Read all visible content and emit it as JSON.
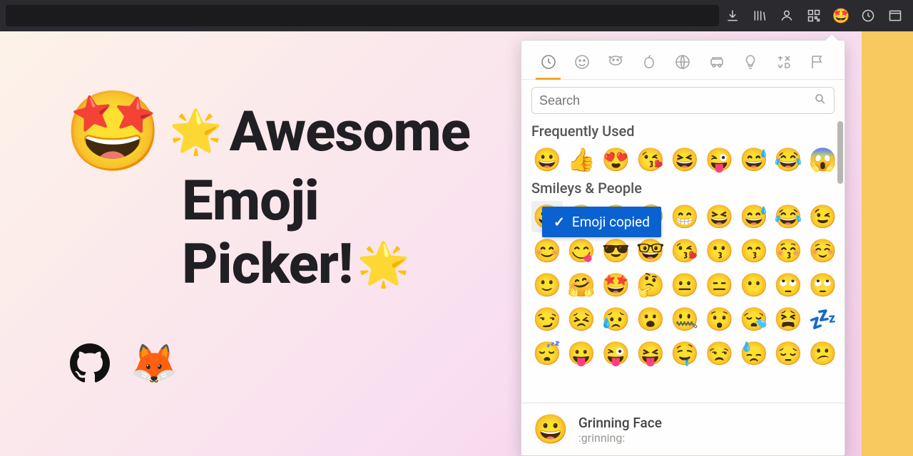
{
  "title": {
    "line1": "Awesome",
    "line2": "Emoji",
    "line3": "Picker!"
  },
  "hero_emoji": "🤩",
  "sparkle": "🌟",
  "browser_icons": [
    "download",
    "library",
    "account",
    "qr",
    "emoji-ext",
    "history",
    "window"
  ],
  "categories": [
    "recent",
    "smileys",
    "animals",
    "food",
    "activity",
    "travel",
    "objects",
    "symbols",
    "flags"
  ],
  "search": {
    "placeholder": "Search"
  },
  "sections": {
    "frequent": {
      "title": "Frequently Used",
      "items": [
        "😀",
        "👍",
        "😍",
        "😘",
        "😆",
        "😜",
        "😅",
        "😂",
        "😱"
      ]
    },
    "smileys": {
      "title": "Smileys & People",
      "rows": [
        [
          "😀",
          "😃",
          "😄",
          "🤣",
          "😁",
          "😆",
          "😅",
          "😂",
          "😉"
        ],
        [
          "😊",
          "😋",
          "😎",
          "🤓",
          "😘",
          "😗",
          "😙",
          "😚",
          "☺️"
        ],
        [
          "🙂",
          "🤗",
          "🤩",
          "🤔",
          "😐",
          "😑",
          "😶",
          "🙄",
          "🙄"
        ],
        [
          "😏",
          "😣",
          "😥",
          "😮",
          "🤐",
          "😯",
          "😪",
          "😫",
          "💤"
        ],
        [
          "😴",
          "😛",
          "😜",
          "😝",
          "🤤",
          "😒",
          "😓",
          "😔",
          "😕"
        ]
      ]
    }
  },
  "toast": {
    "text": "Emoji copied"
  },
  "preview": {
    "emoji": "😀",
    "name": "Grinning Face",
    "code": ":grinning:"
  },
  "footer": {
    "github": "github",
    "firefox": "🦊"
  },
  "colors": {
    "accent": "#f5a623",
    "toast": "#0a62d0"
  }
}
